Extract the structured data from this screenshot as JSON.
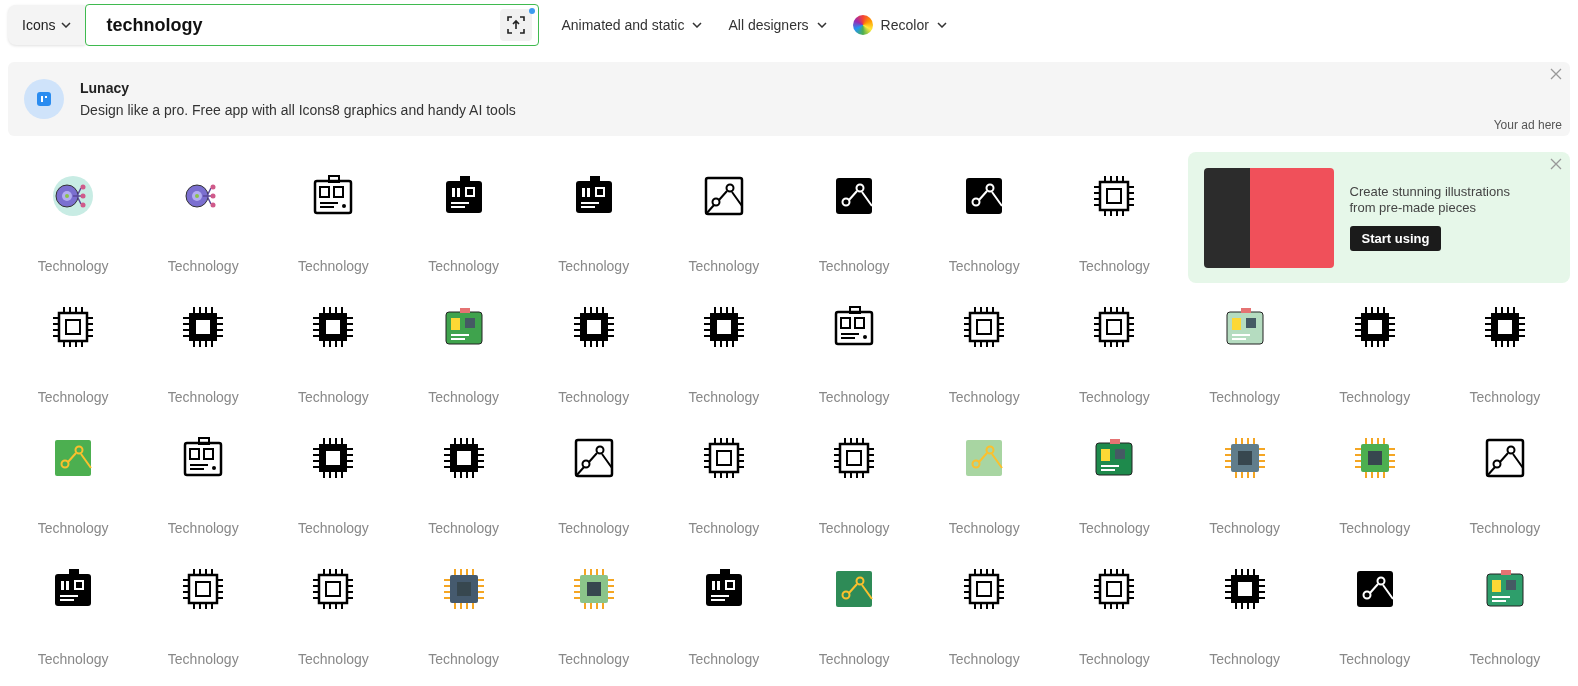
{
  "search": {
    "type_menu": "Icons",
    "value": "technology"
  },
  "filters": [
    {
      "label": "Animated and static",
      "kind": "plain"
    },
    {
      "label": "All designers",
      "kind": "plain"
    },
    {
      "label": "Recolor",
      "kind": "recolor"
    }
  ],
  "banner": {
    "title": "Lunacy",
    "text": "Design like a pro. Free app with all Icons8 graphics and handy AI tools",
    "note": "Your ad here"
  },
  "promo": {
    "text": "Create stunning illustrations from pre-made pieces",
    "button": "Start using"
  },
  "icons": [
    {
      "label": "Technology",
      "kind": "gear-color"
    },
    {
      "label": "Technology",
      "kind": "gear-sticker"
    },
    {
      "label": "Technology",
      "kind": "board-outline"
    },
    {
      "label": "Technology",
      "kind": "board-filled"
    },
    {
      "label": "Technology",
      "kind": "board-filled"
    },
    {
      "label": "Technology",
      "kind": "circuit-outline"
    },
    {
      "label": "Technology",
      "kind": "circuit-filled"
    },
    {
      "label": "Technology",
      "kind": "circuit-filled"
    },
    {
      "label": "Technology",
      "kind": "chip-outline"
    },
    {
      "label": "Technology",
      "kind": "chip-outline"
    },
    {
      "label": "Technology",
      "kind": "chip-filled"
    },
    {
      "label": "Technology",
      "kind": "chip-filled"
    },
    {
      "label": "Technology",
      "kind": "board-color",
      "color": "#3fa34d"
    },
    {
      "label": "Technology",
      "kind": "chip-filled"
    },
    {
      "label": "Technology",
      "kind": "chip-filled"
    },
    {
      "label": "Technology",
      "kind": "board-outline"
    },
    {
      "label": "Technology",
      "kind": "chip-outline"
    },
    {
      "label": "Technology",
      "kind": "chip-outline"
    },
    {
      "label": "Technology",
      "kind": "board-color",
      "color": "#b5dcc0"
    },
    {
      "label": "Technology",
      "kind": "chip-filled"
    },
    {
      "label": "Technology",
      "kind": "chip-filled"
    },
    {
      "label": "Technology",
      "kind": "circuit-color",
      "color": "#4caf50"
    },
    {
      "label": "Technology",
      "kind": "board-outline"
    },
    {
      "label": "Technology",
      "kind": "chip-filled"
    },
    {
      "label": "Technology",
      "kind": "chip-filled"
    },
    {
      "label": "Technology",
      "kind": "circuit-outline"
    },
    {
      "label": "Technology",
      "kind": "chip-outline"
    },
    {
      "label": "Technology",
      "kind": "chip-outline"
    },
    {
      "label": "Technology",
      "kind": "circuit-color",
      "color": "#a8d5a2"
    },
    {
      "label": "Technology",
      "kind": "board-color",
      "color": "#1e8a4c"
    },
    {
      "label": "Technology",
      "kind": "chip-color",
      "color": "#607d8b"
    },
    {
      "label": "Technology",
      "kind": "chip-color",
      "color": "#4caf50"
    },
    {
      "label": "Technology",
      "kind": "circuit-outline"
    },
    {
      "label": "Technology",
      "kind": "board-filled"
    },
    {
      "label": "Technology",
      "kind": "chip-outline"
    },
    {
      "label": "Technology",
      "kind": "chip-outline"
    },
    {
      "label": "Technology",
      "kind": "chip-color",
      "color": "#455a6e"
    },
    {
      "label": "Technology",
      "kind": "chip-color",
      "color": "#8bc48a"
    },
    {
      "label": "Technology",
      "kind": "board-filled"
    },
    {
      "label": "Technology",
      "kind": "circuit-color",
      "color": "#2e8b57"
    },
    {
      "label": "Technology",
      "kind": "chip-outline"
    },
    {
      "label": "Technology",
      "kind": "chip-outline"
    },
    {
      "label": "Technology",
      "kind": "chip-filled"
    },
    {
      "label": "Technology",
      "kind": "circuit-filled"
    },
    {
      "label": "Technology",
      "kind": "board-color",
      "color": "#2e9e6b"
    }
  ]
}
